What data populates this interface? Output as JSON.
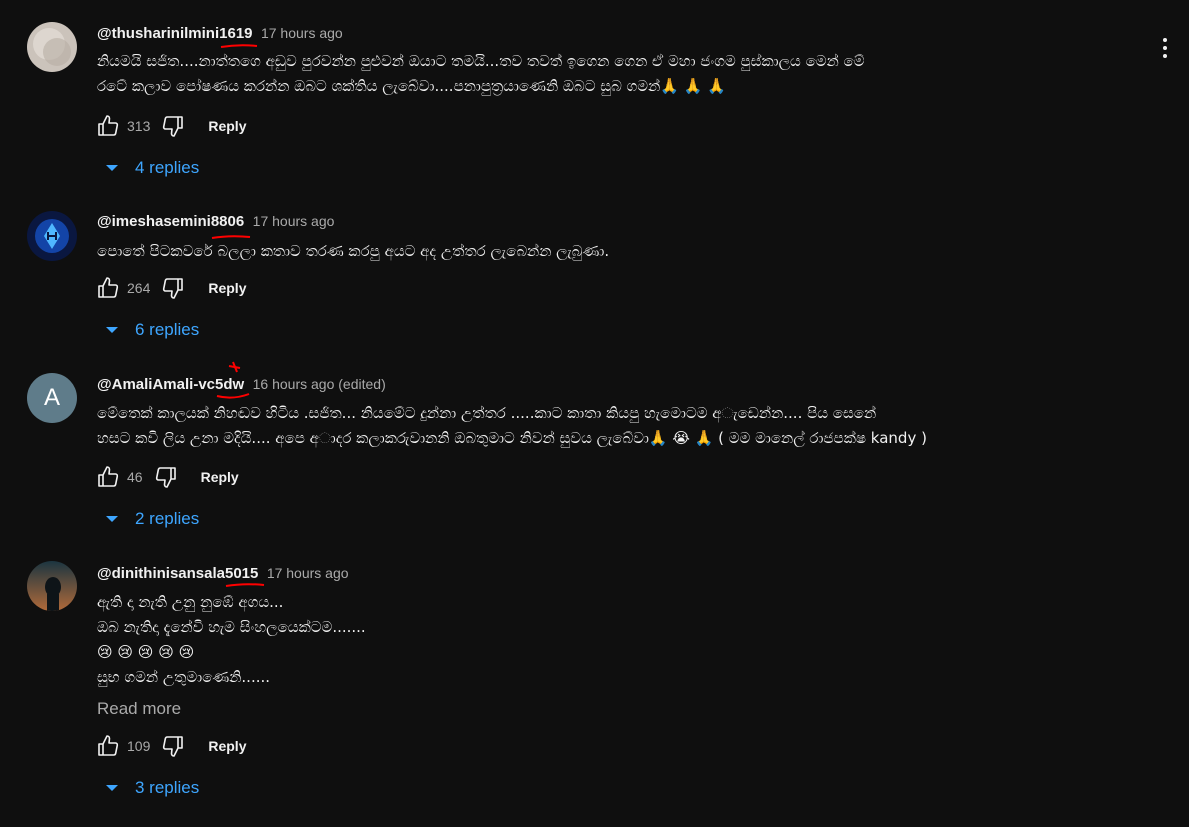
{
  "comments": [
    {
      "author": "@thusharinilmini1619",
      "time": "17 hours ago",
      "text": "නියමයි සජිත....නාත්තගෙ අඩුව පුරවන්න පුළුවන් ඔයාට තමයි...තව තවත් ඉගෙන ගෙන ඒ මහා ජංගම පුස්කාලය මෙන් මේ\nරටේ කලාව පෝෂණය කරන්න ඔබට ශක්තිය ලැබේවා....පනාපුත්‍රයාණෙනි ඔබට සුබ ගමන්🙏 🙏 🙏",
      "likes": "313",
      "reply_label": "Reply",
      "replies_label": "4 replies"
    },
    {
      "author": "@imeshasemini8806",
      "time": "17 hours ago",
      "text": "පොතේ පිටකවරේ බලලා කතාව තරණ කරපු අයට අද උත්තර ලැබෙන්න ලැබුණා.",
      "likes": "264",
      "reply_label": "Reply",
      "replies_label": "6 replies"
    },
    {
      "author": "@AmaliAmali-vc5dw",
      "time": "16 hours ago (edited)",
      "avatar_letter": "A",
      "text": "මේතෙක් කාලයක් නිහඬව හිටිය .සජිත... නියමේට දුන්නා උත්තර .....කාට කාතා කියපු හැමොටම අ◌ැඩෙන්න.... පිය සෙනේ\nහසට කවි ලිය උනා මදියි.... අපෙ අ◌ාදර කලාකරුවානනි ඔබතුමාට නිවන් සුවය ලැබේවා🙏 😭 🙏 ( මම මානෙල් රාජපක්ෂ kandy )",
      "likes": "46",
      "reply_label": "Reply",
      "replies_label": "2 replies"
    },
    {
      "author": "@dinithinisansala5015",
      "time": "17 hours ago",
      "text": "ඇති දා නැති උනු නුඹේ අගය...\nඔබ නැතිදා දැනේවි හැම සිංහලයෙක්ටම.......\n😢 😢 😢 😢 😢\nසුභ ගමන් උතුමාණෙනි......",
      "read_more": "Read more",
      "likes": "109",
      "reply_label": "Reply",
      "replies_label": "3 replies"
    }
  ],
  "icons": {
    "like": "thumbs-up-icon",
    "dislike": "thumbs-down-icon",
    "expand": "chevron-down-icon",
    "menu": "more-vert-icon"
  },
  "colors": {
    "background": "#0f0f0f",
    "link_blue": "#3ea6ff",
    "secondary_text": "#aaaaaa",
    "annotation_red": "#ff0000"
  }
}
